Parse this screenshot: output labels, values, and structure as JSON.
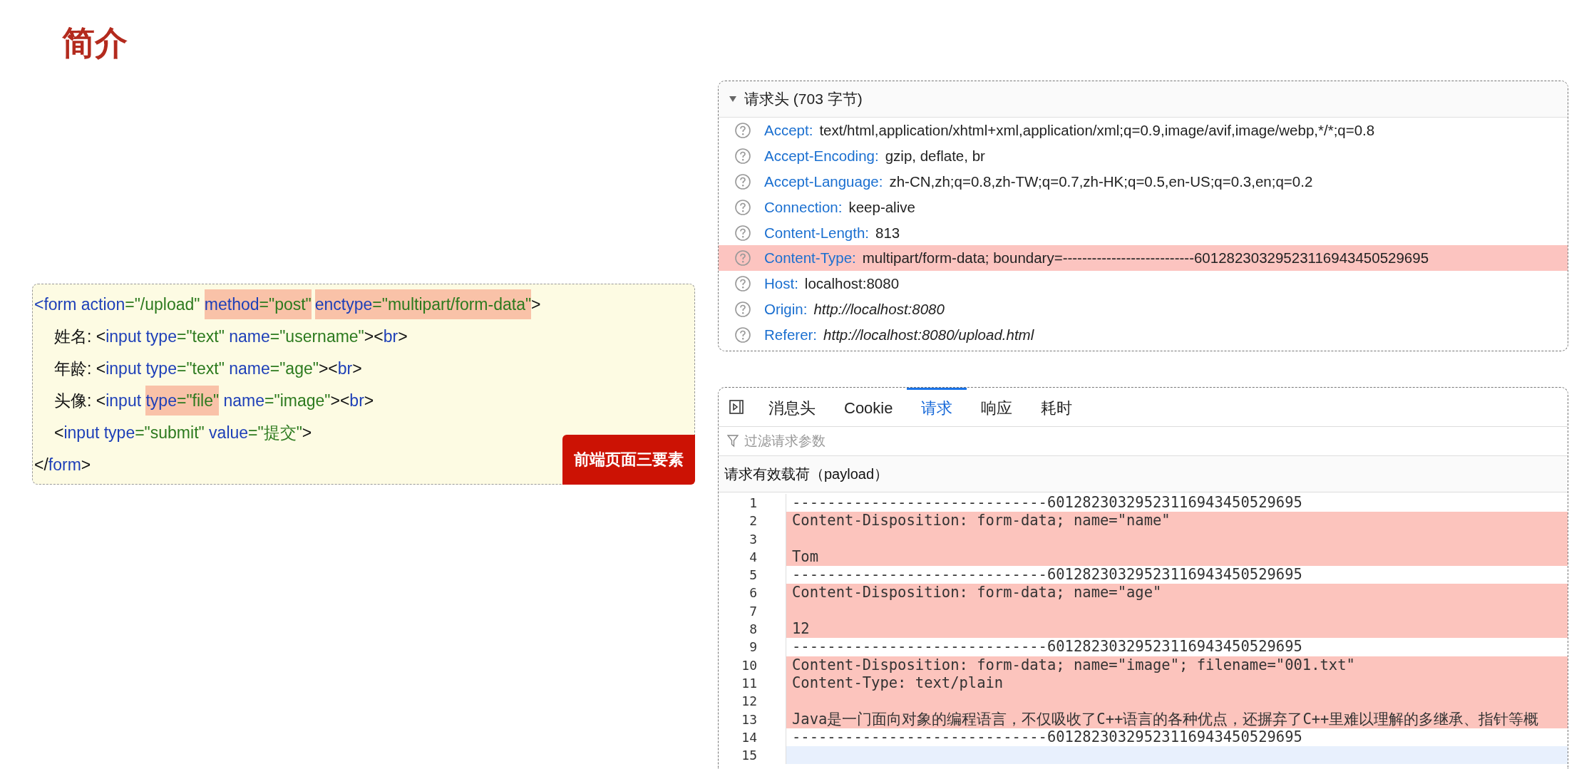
{
  "title": "简介",
  "form_code": {
    "lines": [
      {
        "indented": false,
        "tokens": [
          {
            "text": "<form action",
            "kind": "name",
            "highlighted": false
          },
          {
            "text": "=\"/upload\" ",
            "kind": "value",
            "highlighted": false
          },
          {
            "text": "method",
            "kind": "name",
            "highlighted": true
          },
          {
            "text": "=\"post\"",
            "kind": "value",
            "highlighted": true
          },
          {
            "text": "enctype",
            "kind": "name",
            "highlighted": true
          },
          {
            "text": "=\"multipart/form-data\"",
            "kind": "value",
            "highlighted": true
          },
          {
            "text": ">",
            "kind": "text",
            "highlighted": false
          }
        ]
      },
      {
        "indented": true,
        "tokens": [
          {
            "text": "姓名: <",
            "kind": "text",
            "highlighted": false
          },
          {
            "text": "input type",
            "kind": "name",
            "highlighted": false
          },
          {
            "text": "=\"text\" ",
            "kind": "value",
            "highlighted": false
          },
          {
            "text": "name",
            "kind": "name",
            "highlighted": false
          },
          {
            "text": "=\"username\"",
            "kind": "value",
            "highlighted": false
          },
          {
            "text": "><",
            "kind": "text",
            "highlighted": false
          },
          {
            "text": "br",
            "kind": "name",
            "highlighted": false
          },
          {
            "text": ">",
            "kind": "text",
            "highlighted": false
          }
        ]
      },
      {
        "indented": true,
        "tokens": [
          {
            "text": "年龄: <",
            "kind": "text",
            "highlighted": false
          },
          {
            "text": "input type",
            "kind": "name",
            "highlighted": false
          },
          {
            "text": "=\"text\" ",
            "kind": "value",
            "highlighted": false
          },
          {
            "text": "name",
            "kind": "name",
            "highlighted": false
          },
          {
            "text": "=\"age\"",
            "kind": "value",
            "highlighted": false
          },
          {
            "text": "><",
            "kind": "text",
            "highlighted": false
          },
          {
            "text": "br",
            "kind": "name",
            "highlighted": false
          },
          {
            "text": ">",
            "kind": "text",
            "highlighted": false
          }
        ]
      },
      {
        "indented": true,
        "tokens": [
          {
            "text": "头像: <",
            "kind": "text",
            "highlighted": false
          },
          {
            "text": "input ",
            "kind": "name",
            "highlighted": false
          },
          {
            "text": "type",
            "kind": "name",
            "highlighted": true
          },
          {
            "text": "=\"file\"",
            "kind": "value",
            "highlighted": true
          },
          {
            "text": " name",
            "kind": "name",
            "highlighted": false
          },
          {
            "text": "=\"image\"",
            "kind": "value",
            "highlighted": false
          },
          {
            "text": "><",
            "kind": "text",
            "highlighted": false
          },
          {
            "text": "br",
            "kind": "name",
            "highlighted": false
          },
          {
            "text": ">",
            "kind": "text",
            "highlighted": false
          }
        ]
      },
      {
        "indented": true,
        "tokens": [
          {
            "text": "<",
            "kind": "text",
            "highlighted": false
          },
          {
            "text": "input type",
            "kind": "name",
            "highlighted": false
          },
          {
            "text": "=\"submit\" ",
            "kind": "value",
            "highlighted": false
          },
          {
            "text": "value",
            "kind": "name",
            "highlighted": false
          },
          {
            "text": "=\"提交\"",
            "kind": "value",
            "highlighted": false
          },
          {
            "text": ">",
            "kind": "text",
            "highlighted": false
          }
        ]
      },
      {
        "indented": false,
        "tokens": [
          {
            "text": "</",
            "kind": "text",
            "highlighted": false
          },
          {
            "text": "form",
            "kind": "name",
            "highlighted": false
          },
          {
            "text": ">",
            "kind": "text",
            "highlighted": false
          }
        ]
      }
    ],
    "badge": "前端页面三要素"
  },
  "request_headers": {
    "heading": "请求头 (703 字节)",
    "expanded": true,
    "rows": [
      {
        "name": "Accept:",
        "value": "text/html,application/xhtml+xml,application/xml;q=0.9,image/avif,image/webp,*/*;q=0.8",
        "italic": false,
        "highlighted": false
      },
      {
        "name": "Accept-Encoding:",
        "value": "gzip, deflate, br",
        "italic": false,
        "highlighted": false
      },
      {
        "name": "Accept-Language:",
        "value": "zh-CN,zh;q=0.8,zh-TW;q=0.7,zh-HK;q=0.5,en-US;q=0.3,en;q=0.2",
        "italic": false,
        "highlighted": false
      },
      {
        "name": "Connection:",
        "value": "keep-alive",
        "italic": false,
        "highlighted": false
      },
      {
        "name": "Content-Length:",
        "value": "813",
        "italic": false,
        "highlighted": false
      },
      {
        "name": "Content-Type:",
        "value": "multipart/form-data; boundary=---------------------------60128230329523116943450529695",
        "italic": false,
        "highlighted": true
      },
      {
        "name": "Host:",
        "value": "localhost:8080",
        "italic": false,
        "highlighted": false
      },
      {
        "name": "Origin:",
        "value": "http://localhost:8080",
        "italic": true,
        "highlighted": false
      },
      {
        "name": "Referer:",
        "value": "http://localhost:8080/upload.html",
        "italic": true,
        "highlighted": false
      }
    ]
  },
  "request_panel": {
    "tabs": [
      {
        "label": "消息头",
        "selected": false
      },
      {
        "label": "Cookie",
        "selected": false
      },
      {
        "label": "请求",
        "selected": true
      },
      {
        "label": "响应",
        "selected": false
      },
      {
        "label": "耗时",
        "selected": false
      }
    ],
    "filter": {
      "placeholder": "过滤请求参数"
    },
    "payload_label": "请求有效载荷（payload）",
    "payload_lines": [
      {
        "number": "1",
        "text": "-----------------------------60128230329523116943450529695",
        "highlighted": false,
        "current": false
      },
      {
        "number": "2",
        "text": "Content-Disposition: form-data; name=\"name\"",
        "highlighted": true,
        "current": false
      },
      {
        "number": "3",
        "highlighted": true,
        "current": false
      },
      {
        "number": "4",
        "text": "Tom",
        "highlighted": true,
        "current": false
      },
      {
        "number": "5",
        "text": "-----------------------------60128230329523116943450529695",
        "highlighted": false,
        "current": false
      },
      {
        "number": "6",
        "text": "Content-Disposition: form-data; name=\"age\"",
        "highlighted": true,
        "current": false
      },
      {
        "number": "7",
        "highlighted": true,
        "current": false
      },
      {
        "number": "8",
        "text": "12",
        "highlighted": true,
        "current": false
      },
      {
        "number": "9",
        "text": "-----------------------------60128230329523116943450529695",
        "highlighted": false,
        "current": false
      },
      {
        "number": "10",
        "text": "Content-Disposition: form-data; name=\"image\"; filename=\"001.txt\"",
        "highlighted": true,
        "current": false
      },
      {
        "number": "11",
        "text": "Content-Type: text/plain",
        "highlighted": true,
        "current": false
      },
      {
        "number": "12",
        "highlighted": true,
        "current": false
      },
      {
        "number": "13",
        "text": "Java是一门面向对象的编程语言，不仅吸收了C++语言的各种优点，还摒弃了C++里难以理解的多继承、指针等概",
        "highlighted": true,
        "current": false
      },
      {
        "number": "14",
        "text": "-----------------------------60128230329523116943450529695",
        "highlighted": false,
        "current": false
      },
      {
        "number": "15",
        "highlighted": false,
        "current": true
      }
    ]
  }
}
